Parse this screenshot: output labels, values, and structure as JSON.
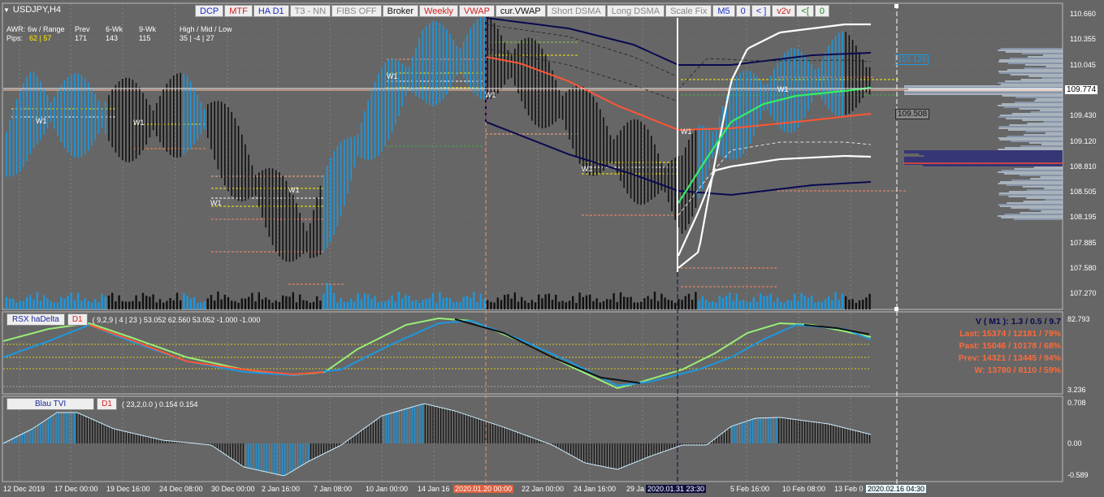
{
  "symbol": {
    "title": "USDJPY,H4"
  },
  "toolbar": {
    "buttons": [
      {
        "label": "DCP",
        "color": "#1a2fc8"
      },
      {
        "label": "MTF",
        "color": "#d02020"
      },
      {
        "label": "HA D1",
        "color": "#1a2fc8"
      },
      {
        "label": "T3 - NN",
        "color": "#888888"
      },
      {
        "label": "FIBS OFF",
        "color": "#888888"
      },
      {
        "label": "Broker",
        "color": "#111111"
      },
      {
        "label": "Weekly",
        "color": "#d02020"
      },
      {
        "label": "VWAP",
        "color": "#d02020"
      },
      {
        "label": "cur.VWAP",
        "color": "#111111"
      },
      {
        "label": "Short DSMA",
        "color": "#888888"
      },
      {
        "label": "Long DSMA",
        "color": "#888888"
      },
      {
        "label": "Scale Fix",
        "color": "#888888"
      },
      {
        "label": "M5",
        "color": "#1a2fc8"
      },
      {
        "label": "0",
        "color": "#1a2fc8"
      },
      {
        "label": "< ]",
        "color": "#1a2fc8"
      },
      {
        "label": "v2v",
        "color": "#d02020"
      },
      {
        "label": "<[",
        "color": "#1a8a1a"
      },
      {
        "label": "0",
        "color": "#1a8a1a"
      }
    ]
  },
  "stats": {
    "awr_label": "AWR:",
    "awr_cols": "6w / Range",
    "prev_label": "Prev",
    "wk6_label": "6-Wk",
    "wk9_label": "9-Wk",
    "hml_label": "High / Mid / Low",
    "pips_label": "Pips:",
    "pips_val": "62 | 57",
    "prev_val": "171",
    "wk6_val": "143",
    "wk9_val": "115",
    "hml_val": "35  |  -4  |  27"
  },
  "price_axis": [
    "110.660",
    "110.355",
    "110.045",
    "109.740",
    "109.430",
    "109.120",
    "108.810",
    "108.505",
    "108.195",
    "107.885",
    "107.580",
    "107.270"
  ],
  "price_boxes": {
    "upper": "110.128",
    "current": "109.774",
    "lower": "109.508"
  },
  "rsx_axis": {
    "top": "82.793",
    "bottom": "3.236"
  },
  "tvi_axis": {
    "top": "0.708",
    "mid": "0.00",
    "bottom": "-0.589"
  },
  "time_axis": [
    {
      "label": "12 Dec 2019"
    },
    {
      "label": "17 Dec 00:00"
    },
    {
      "label": "19 Dec 16:00"
    },
    {
      "label": "24 Dec 08:00"
    },
    {
      "label": "30 Dec 00:00"
    },
    {
      "label": "2 Jan 16:00"
    },
    {
      "label": "7 Jan 08:00"
    },
    {
      "label": "10 Jan 00:00"
    },
    {
      "label": "14 Jan 16"
    },
    {
      "label": "22 Jan 00:00"
    },
    {
      "label": "24 Jan 16:00"
    },
    {
      "label": "29 Ja"
    },
    {
      "label": "5 Feb 16:00"
    },
    {
      "label": "10 Feb 08:00"
    },
    {
      "label": "13 Feb 0"
    }
  ],
  "time_markers": [
    {
      "label": "2020.01.20 00:00",
      "bg": "#e06040"
    },
    {
      "label": "2020.01.31 23:30",
      "bg": "#101040"
    },
    {
      "label": "2020.02.16 04:30",
      "bg": "#e8f8ff"
    }
  ],
  "w1_labels": [
    "W1",
    "W1",
    "W1",
    "W1",
    "W1",
    "W1",
    "W1",
    "W1",
    "W1"
  ],
  "rsx": {
    "name": "RSX haDelta",
    "tf": "D1",
    "params": "( 9,2,9 | 4 | 23 ) 53.052 62.560 53.052 -1.000 -1.000",
    "v_line": "V ( M1 ): 1.3 / 0.5 / 9.7",
    "last": "Last: 15374 / 12181 / 79%",
    "past": "Past: 15046 / 10178 / 68%",
    "prev": "Prev: 14321 / 13445 / 94%",
    "w": "W: 13780 / 8110 / 59%"
  },
  "tvi": {
    "name": "Blau TVI",
    "tf": "D1",
    "params": "( 23,2,0.0 ) 0.154 0.154"
  },
  "colors": {
    "blue": "#1b98e0",
    "black": "#111111",
    "navy": "#0a0a50",
    "red": "#ff5533",
    "green": "#33ee66",
    "lime": "#99ee77",
    "yellow": "#ffee00"
  }
}
